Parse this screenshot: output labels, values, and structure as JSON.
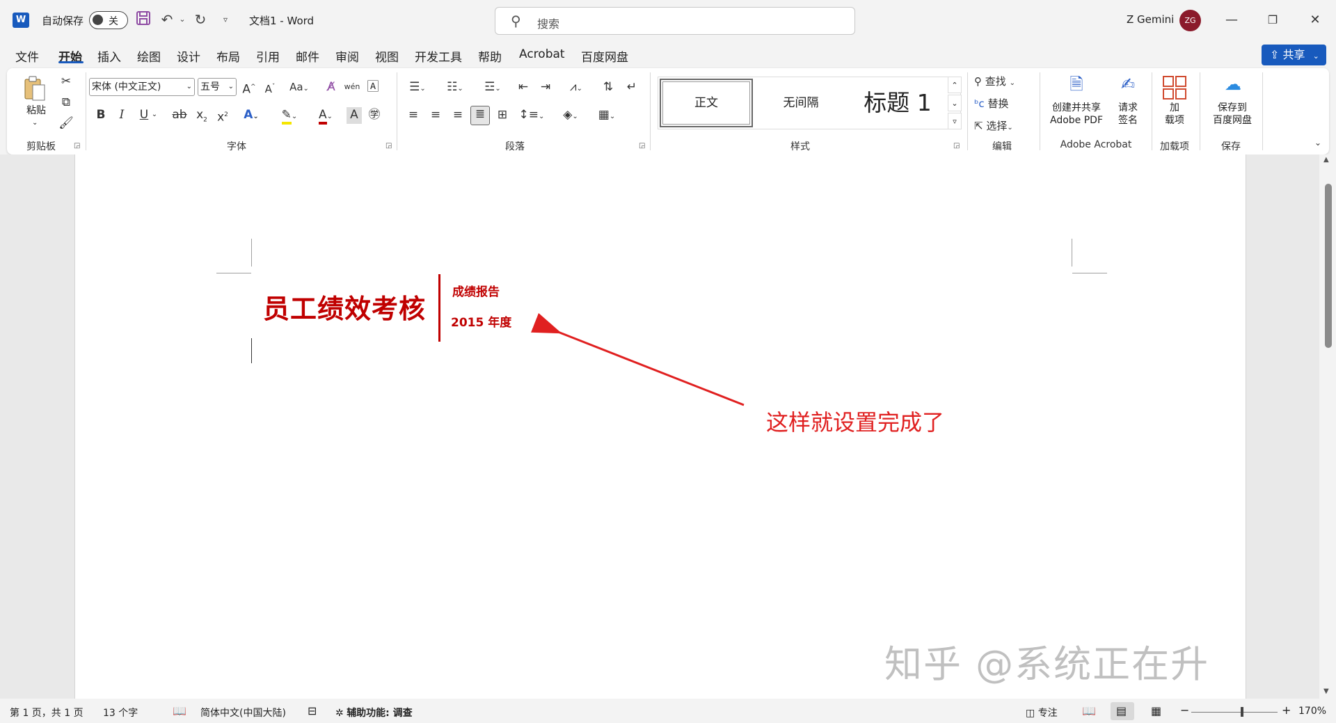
{
  "titlebar": {
    "autosave_label": "自动保存",
    "autosave_state": "关",
    "doc_title": "文档1  -  Word",
    "search_placeholder": "搜索",
    "user_name": "Z Gemini",
    "avatar_initials": "ZG",
    "logo_letter": "W"
  },
  "menu": {
    "items": [
      "文件",
      "开始",
      "插入",
      "绘图",
      "设计",
      "布局",
      "引用",
      "邮件",
      "审阅",
      "视图",
      "开发工具",
      "帮助",
      "Acrobat",
      "百度网盘"
    ],
    "active": "开始",
    "share_label": "共享"
  },
  "ribbon": {
    "clipboard": {
      "paste": "粘贴",
      "label": "剪贴板"
    },
    "font": {
      "family": "宋体 (中文正文)",
      "size": "五号",
      "change_case": "Aa",
      "label": "字体"
    },
    "paragraph": {
      "label": "段落"
    },
    "styles": {
      "items": [
        "正文",
        "无间隔",
        "标题 1"
      ],
      "label": "样式"
    },
    "editing": {
      "find": "查找",
      "replace": "替换",
      "select": "选择",
      "label": "编辑"
    },
    "acrobat": {
      "create_line1": "创建并共享",
      "create_line2": "Adobe PDF",
      "sign_line1": "请求",
      "sign_line2": "签名",
      "label": "Adobe Acrobat"
    },
    "addins": {
      "line1": "加",
      "line2": "载项",
      "label": "加载项"
    },
    "save": {
      "line1": "保存到",
      "line2": "百度网盘",
      "label": "保存"
    }
  },
  "document": {
    "headline": "员工绩效考核",
    "sub1": "成绩报告",
    "sub2": "2015 年度",
    "annotation": "这样就设置完成了",
    "watermark": "知乎 @系统正在升级ing"
  },
  "statusbar": {
    "page": "第 1 页，共 1 页",
    "words": "13 个字",
    "language": "简体中文(中国大陆)",
    "accessibility": "辅助功能: 调查",
    "focus": "专注",
    "zoom": "170%"
  },
  "colors": {
    "accent": "#185abd",
    "doc_red": "#c00000",
    "annotation_red": "#e02020"
  }
}
